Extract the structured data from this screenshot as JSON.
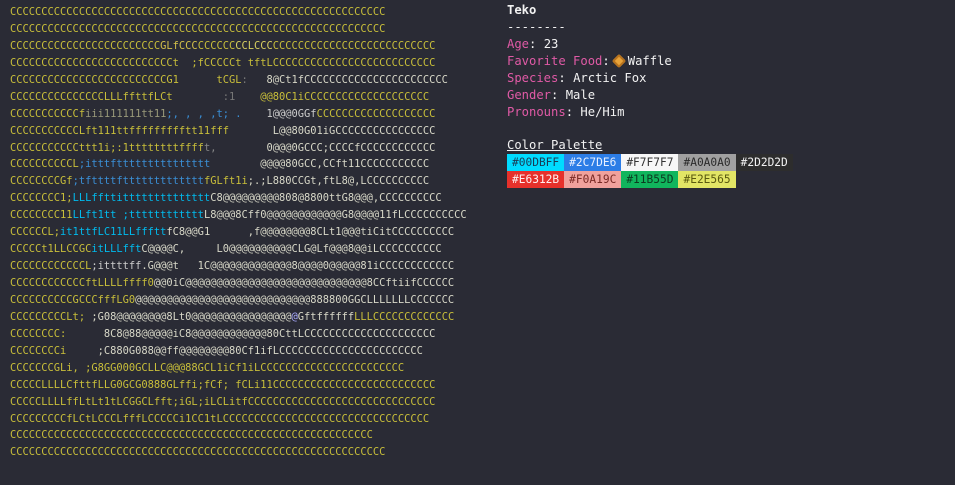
{
  "ascii_art": {
    "rows": [
      [
        [
          "CCCCCCCCCCCCCCCCCCCCCCCCCCCCCCCCCCCCCCCCCCCCCCCCCCCCCCCCCCCC",
          "#c9bf3a"
        ]
      ],
      [
        [
          "CCCCCCCCCCCCCCCCCCCCCCCCCCCCCCCCCCCCCCCCCCCCCCCCCCCCCCCCCCCC",
          "#c9bf3a"
        ]
      ],
      [
        [
          "CCCCCCCCCCCCCCCCCCCCCCCC",
          "#c9bf3a"
        ],
        [
          "GLfCCC",
          "#d4c14a"
        ],
        [
          "CCCCCC",
          "#c9bf3a"
        ],
        [
          "CCLCCC",
          "#d8d060"
        ],
        [
          "CCCCCCCCCCCCCCCCCCCCCCCCCC",
          "#c9bf3a"
        ]
      ],
      [
        [
          "CCCCCCCCCCCCCCCCCCCCCCCCCCt",
          "#c9bf3a"
        ],
        [
          "  ;fCCCCCt",
          "#c9bf3a"
        ],
        [
          " tftLCCCCCCC",
          "#c9bf3a"
        ],
        [
          "CCCCCCCCCCCCCCCCCCC",
          "#c9bf3a"
        ]
      ],
      [
        [
          "CCCCCCCCCCCCCCCCCCCCCCCCCG1",
          "#c9bf3a"
        ],
        [
          "      tCGL",
          "#c9bf3a"
        ],
        [
          ":   ",
          "#777"
        ],
        [
          "8@Ct1fCCCCCCCCCCCCCCCCCCCCCCC",
          "#d8d8c8"
        ]
      ],
      [
        [
          "CCCCCCCCCCCCCCCLLLfftt",
          "#c9bf3a"
        ],
        [
          "fLCt",
          "#c9bf3a"
        ],
        [
          "        :1",
          "#777"
        ],
        [
          "    ",
          "#777"
        ],
        [
          "@@80C1iCCCCCCCCCCCCCCCCCCCC",
          "#c9bf3a"
        ]
      ],
      [
        [
          "CCCCCCCCCCCf",
          "#c9bf3a"
        ],
        [
          "iii111111tt11",
          "#9a9a7a"
        ],
        [
          ";, , , ,t; .  ",
          "#3a8fd6"
        ],
        [
          "  1@@@0GGf",
          "#cccccc"
        ],
        [
          "CCCCCCCCCCCCCCCCCCC",
          "#c9bf3a"
        ]
      ],
      [
        [
          "CCCCCCCCCCCLft11",
          "#c9bf3a"
        ],
        [
          "1ttffffffffftt11",
          "#c9bf3a"
        ],
        [
          "fff       ",
          "#c9bf3a"
        ],
        [
          "L@@80G01iGCCCCCCCCCCCCCCCC",
          "#d8d8c8"
        ]
      ],
      [
        [
          "CCCCCCCCCCCttt1i",
          "#c9bf3a"
        ],
        [
          ";:1ttttttttffff",
          "#c9bf3a"
        ],
        [
          "t,        ",
          "#888"
        ],
        [
          "0@@@0GCCC;CCCCfCCCCCCCCCCCC",
          "#d8d8c8"
        ]
      ],
      [
        [
          "CCCCCCCCCCL",
          "#c9bf3a"
        ],
        [
          ";itttfttttttttttttttt",
          "#3a8fd6"
        ],
        [
          "        ",
          "#777"
        ],
        [
          "@@@@80GCC,CCft11CCCCCCCCCCC",
          "#d8d8c8"
        ]
      ],
      [
        [
          "CCCCCCCCGf",
          "#c9bf3a"
        ],
        [
          ";tfttttfttttttttttttt",
          "#3a8fd6"
        ],
        [
          "fGLft1i",
          "#c9bf3a"
        ],
        [
          ";.;L880CCGt,ftL8@,LCCCCCCCCCC",
          "#d8d8c8"
        ]
      ],
      [
        [
          "CCCCCCCC1;",
          "#c9bf3a"
        ],
        [
          "LLLffttitttttttttttttt",
          "#00bbee"
        ],
        [
          "C8@@@@@@@@@808@8800ttG8@@@,CCCCCCCCCC",
          "#d8d8c8"
        ]
      ],
      [
        [
          "CCCCCCCC11",
          "#c9bf3a"
        ],
        [
          "LLft1tt ;tttttttttttt",
          "#00bbee"
        ],
        [
          "L8@@@8Cff0@@@@@@@@@@@@G8@@@@11fLCCCCCCCCCC",
          "#d8d8c8"
        ]
      ],
      [
        [
          "CCCCCCL;",
          "#c9bf3a"
        ],
        [
          "it1ttfLC11LLffftt",
          "#00bbee"
        ],
        [
          "fC8@@G1      ,f@@@@@@@@8CLt1@@@tiCitCCCCCCCCCC",
          "#d8d8c8"
        ]
      ],
      [
        [
          "CCCCCt1LLCCGC",
          "#c9bf3a"
        ],
        [
          "itLLLfft",
          "#00bbee"
        ],
        [
          "C@@@@C,     L0@@@@@@@@@@CLG@Lf@@@8@@iLCCCCCCCCCC",
          "#d8d8c8"
        ]
      ],
      [
        [
          "CCCCCCCCCCCCL",
          "#c9bf3a"
        ],
        [
          ";ittttff",
          "#cccccc"
        ],
        [
          ".G@@@t   1C@@@@@@@@@@@@@8@@@@0@@@@@81iCCCCCCCCCCCC",
          "#d8d8c8"
        ]
      ],
      [
        [
          "CCCCCCCCCCCCftLLLLffff0",
          "#c9bf3a"
        ],
        [
          "@@0iC@@@@@@@@@@@@@@@@@@@@@@@@@@@@@8CCftiifCCCCCC",
          "#d8d8c8"
        ]
      ],
      [
        [
          "CCCCCCCCCCGCCCfffLG0",
          "#c9bf3a"
        ],
        [
          "@@@@@@@@@@@@@@@@@@@@@@@@@@@@888800GGCLLLLLLLCCCCCCC",
          "#d8d8c8"
        ]
      ],
      [
        [
          "CCCCCCCCCLt;",
          "#c9bf3a"
        ],
        [
          " ;G08@@@@@@@@8Lt0@@@@@@@@@@@@@@@@",
          "#d8d8c8"
        ],
        [
          "@",
          "#aaaaff"
        ],
        [
          "Gftffffff",
          "#d8d8c8"
        ],
        [
          "LLLCCCCCCCCCCCCC",
          "#c9bf3a"
        ]
      ],
      [
        [
          "CCCCCCCC:",
          "#c9bf3a"
        ],
        [
          "      8C8@88@@@@@iC8@@@@@@@@@@@@80CttLCCCCCCCCCCCCCCCCCCCCC",
          "#d8d8c8"
        ]
      ],
      [
        [
          "CCCCCCCCi",
          "#c9bf3a"
        ],
        [
          "     ;C880G088@@ff@@@@@@@@80Cf1ifLCCCCCCCCCCCCCCCCCCCCCCC",
          "#d8d8c8"
        ]
      ],
      [
        [
          "CCCCCCCGLi, ;",
          "#c9bf3a"
        ],
        [
          "G8GG000GCLLC@@@88GCL1iCf1iLCCCCCCCCCCCCCCCCCCCCCCC",
          "#c9bf3a"
        ]
      ],
      [
        [
          "CCCCCLLLLCfttfLLG0GCG0888GLffi;fCf; fCLi11CCCCCCCCCCCCCCCCCCCCCCCCCC",
          "#c9bf3a"
        ]
      ],
      [
        [
          "CCCCCLLLLffLtLt1tLCGGCLfft;iGL;iLCLitfCCCCCCCCCCCCCCCCCCCCCCCCCCCCCC",
          "#c9bf3a"
        ]
      ],
      [
        [
          "CCCCCCCCCfLCtLCCCLfffLCCCCCi1CC1tLCCCCCCCCCCCCCCCCCCCCCCCCCCCCCCCCC",
          "#c9bf3a"
        ]
      ],
      [
        [
          "CCCCCCCCCCCCCCCCCCCCCCCCCCCCCCCCCCCCCCCCCCCCCCCCCCCCCCCCCC",
          "#c9bf3a"
        ]
      ],
      [
        [
          "CCCCCCCCCCCCCCCCCCCCCCCCCCCCCCCCCCCCCCCCCCCCCCCCCCCCCCCCCCCC",
          "#c9bf3a"
        ]
      ]
    ]
  },
  "info": {
    "name": "Teko",
    "separator": "--------",
    "age_key": "Age",
    "age_value": "23",
    "food_key": "Favorite Food",
    "food_icon": "waffle-icon",
    "food_value": "Waffle",
    "species_key": "Species",
    "species_value": "Arctic Fox",
    "gender_key": "Gender",
    "gender_value": "Male",
    "pronouns_key": "Pronouns",
    "pronouns_value": "He/Him"
  },
  "palette": {
    "title": "Color Palette",
    "row1": [
      {
        "label": "#00DBFF",
        "bg": "#00DBFF",
        "fg": "#1a3a55"
      },
      {
        "label": "#2C7DE6",
        "bg": "#2C7DE6",
        "fg": "#e8f0ff"
      },
      {
        "label": "#F7F7F7",
        "bg": "#F7F7F7",
        "fg": "#333333"
      },
      {
        "label": "#A0A0A0",
        "bg": "#A0A0A0",
        "fg": "#2a2a2a"
      },
      {
        "label": "#2D2D2D",
        "bg": "#2D2D2D",
        "fg": "#f2f2f2"
      }
    ],
    "row2": [
      {
        "label": "#E6312B",
        "bg": "#E6312B",
        "fg": "#fff0f0"
      },
      {
        "label": "#F0A19C",
        "bg": "#F0A19C",
        "fg": "#7a2a25"
      },
      {
        "label": "#11B55D",
        "bg": "#11B55D",
        "fg": "#0c3a20"
      },
      {
        "label": "#E2E565",
        "bg": "#E2E565",
        "fg": "#5a5a10"
      }
    ]
  }
}
